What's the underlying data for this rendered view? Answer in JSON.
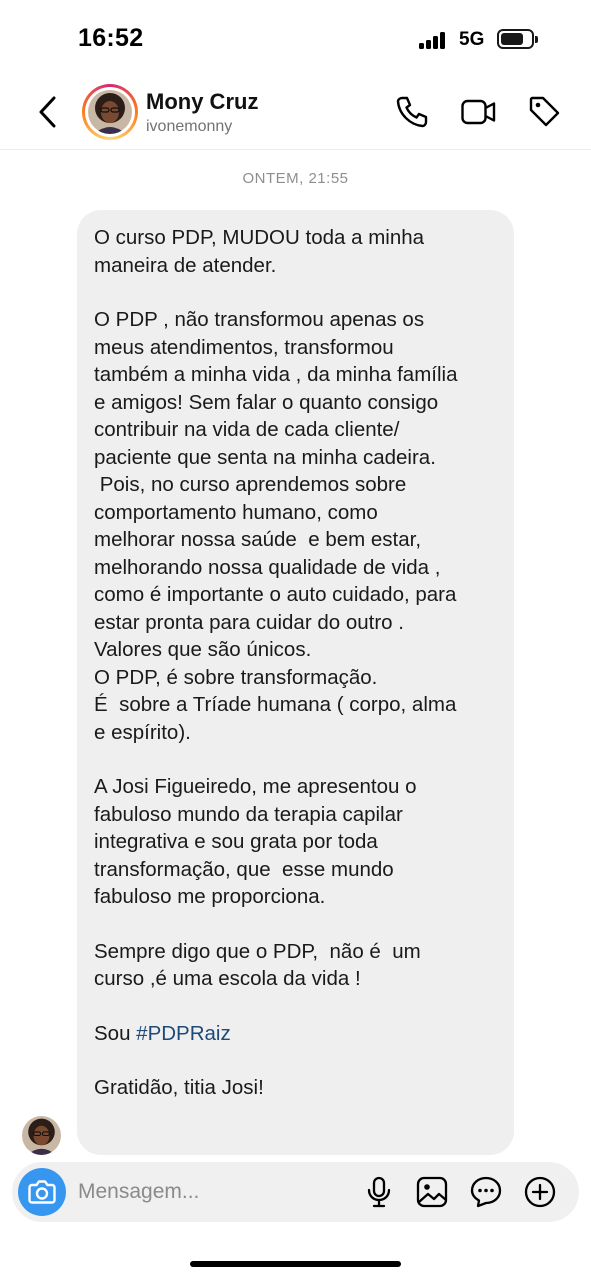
{
  "status": {
    "time": "16:52",
    "network": "5G"
  },
  "header": {
    "name": "Mony Cruz",
    "handle": "ivonemonny",
    "icons": [
      "chevron-left-icon",
      "phone-icon",
      "video-icon",
      "tag-icon"
    ]
  },
  "chat": {
    "timestamp": "ONTEM, 21:55",
    "message": {
      "p1": "O curso PDP, MUDOU toda a minha\nmaneira de atender.",
      "p2": "O PDP , não transformou apenas os\nmeus atendimentos, transformou\ntambém a minha vida , da minha família\ne amigos! Sem falar o quanto consigo\ncontribuir na vida de cada cliente/\npaciente que senta na minha cadeira.\n Pois, no curso aprendemos sobre\ncomportamento humano, como\nmelhorar nossa saúde  e bem estar,\nmelhorando nossa qualidade de vida ,\ncomo é importante o auto cuidado, para\nestar pronta para cuidar do outro .\nValores que são únicos.\nO PDP, é sobre transformação.\nÉ  sobre a Tríade humana ( corpo, alma\ne espírito).",
      "p3": "A Josi Figueiredo, me apresentou o\nfabuloso mundo da terapia capilar\nintegrativa e sou grata por toda\ntransformação, que  esse mundo\nfabuloso me proporciona.",
      "p4": "Sempre digo que o PDP,  não é  um\ncurso ,é uma escola da vida !",
      "p5_prefix": "Sou ",
      "p5_hashtag": "#PDPRaiz",
      "p6": "Gratidão, titia Josi!"
    }
  },
  "composer": {
    "placeholder": "Mensagem...",
    "icons": [
      "camera-icon",
      "microphone-icon",
      "gallery-icon",
      "sticker-icon",
      "plus-icon"
    ]
  },
  "colors": {
    "accent": "#3797f0",
    "bubble": "#efefef",
    "hashtag": "#1e4a7a"
  }
}
